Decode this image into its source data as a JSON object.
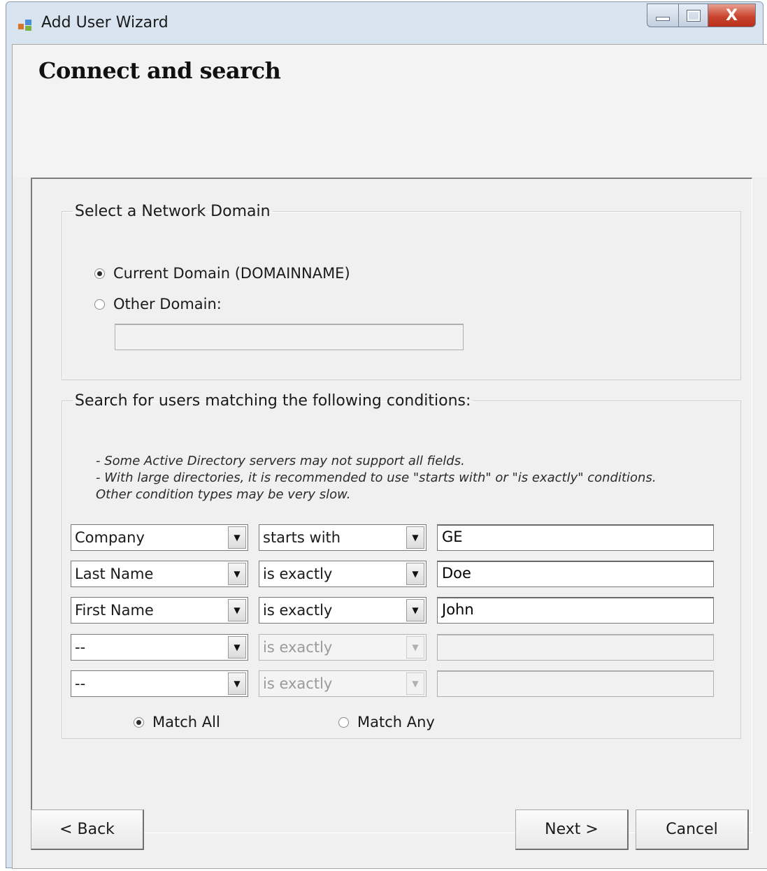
{
  "window": {
    "title": "Add User Wizard",
    "icon": "app-icon",
    "controls": {
      "minimize": "minimize-icon",
      "maximize": "maximize-icon",
      "close_label": "X"
    }
  },
  "header": {
    "title": "Connect and search"
  },
  "domain_group": {
    "legend": "Select a Network Domain",
    "current_domain_label": "Current Domain (DOMAINNAME)",
    "current_domain_selected": true,
    "other_domain_label": "Other Domain:",
    "other_domain_selected": false,
    "other_domain_value": ""
  },
  "search_group": {
    "legend": "Search for users matching the following conditions:",
    "notes": [
      "- Some Active Directory servers may not support all fields.",
      "- With large directories, it is recommended to use \"starts with\" or \"is exactly\" conditions.",
      "Other condition types may be very slow."
    ],
    "conditions": [
      {
        "field": "Company",
        "operator": "starts with",
        "value": "GE",
        "enabled": true
      },
      {
        "field": "Last Name",
        "operator": "is exactly",
        "value": "Doe",
        "enabled": true
      },
      {
        "field": "First Name",
        "operator": "is exactly",
        "value": "John",
        "enabled": true
      },
      {
        "field": "--",
        "operator": "is exactly",
        "value": "",
        "enabled": false
      },
      {
        "field": "--",
        "operator": "is exactly",
        "value": "",
        "enabled": false
      }
    ],
    "match_all_label": "Match All",
    "match_all_selected": true,
    "match_any_label": "Match Any",
    "match_any_selected": false
  },
  "footer": {
    "back_label": "< Back",
    "next_label": "Next >",
    "cancel_label": "Cancel"
  },
  "colors": {
    "title_bar": "#d9e4f1",
    "close_button": "#c9452f",
    "dialog_bg": "#f0f0f0"
  }
}
